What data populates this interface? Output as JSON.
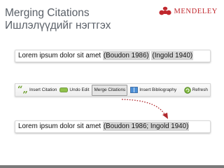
{
  "slide": {
    "title_line1": "Merging Citations",
    "title_line2": "Ишлэлүүдийг нэгтгэх"
  },
  "logo": {
    "text": "MENDELEY",
    "color": "#c0272d"
  },
  "before": {
    "text": "Lorem ipsum dolor sit amet ",
    "citation1": "(Boudon 1986)",
    "citation2": "(Ingold 1940)"
  },
  "toolbar": {
    "insert_citation": "Insert Citation",
    "undo_edit": "Undo Edit",
    "merge_citations": "Merge Citations",
    "insert_bibliography": "Insert Bibliography",
    "refresh": "Refresh"
  },
  "after": {
    "text": "Lorem ipsum dolor sit amet ",
    "citation": "(Boudon 1986; Ingold 1940)"
  },
  "colors": {
    "accent": "#c0272d",
    "arrow": "#b0282d",
    "title": "#5a6068"
  }
}
